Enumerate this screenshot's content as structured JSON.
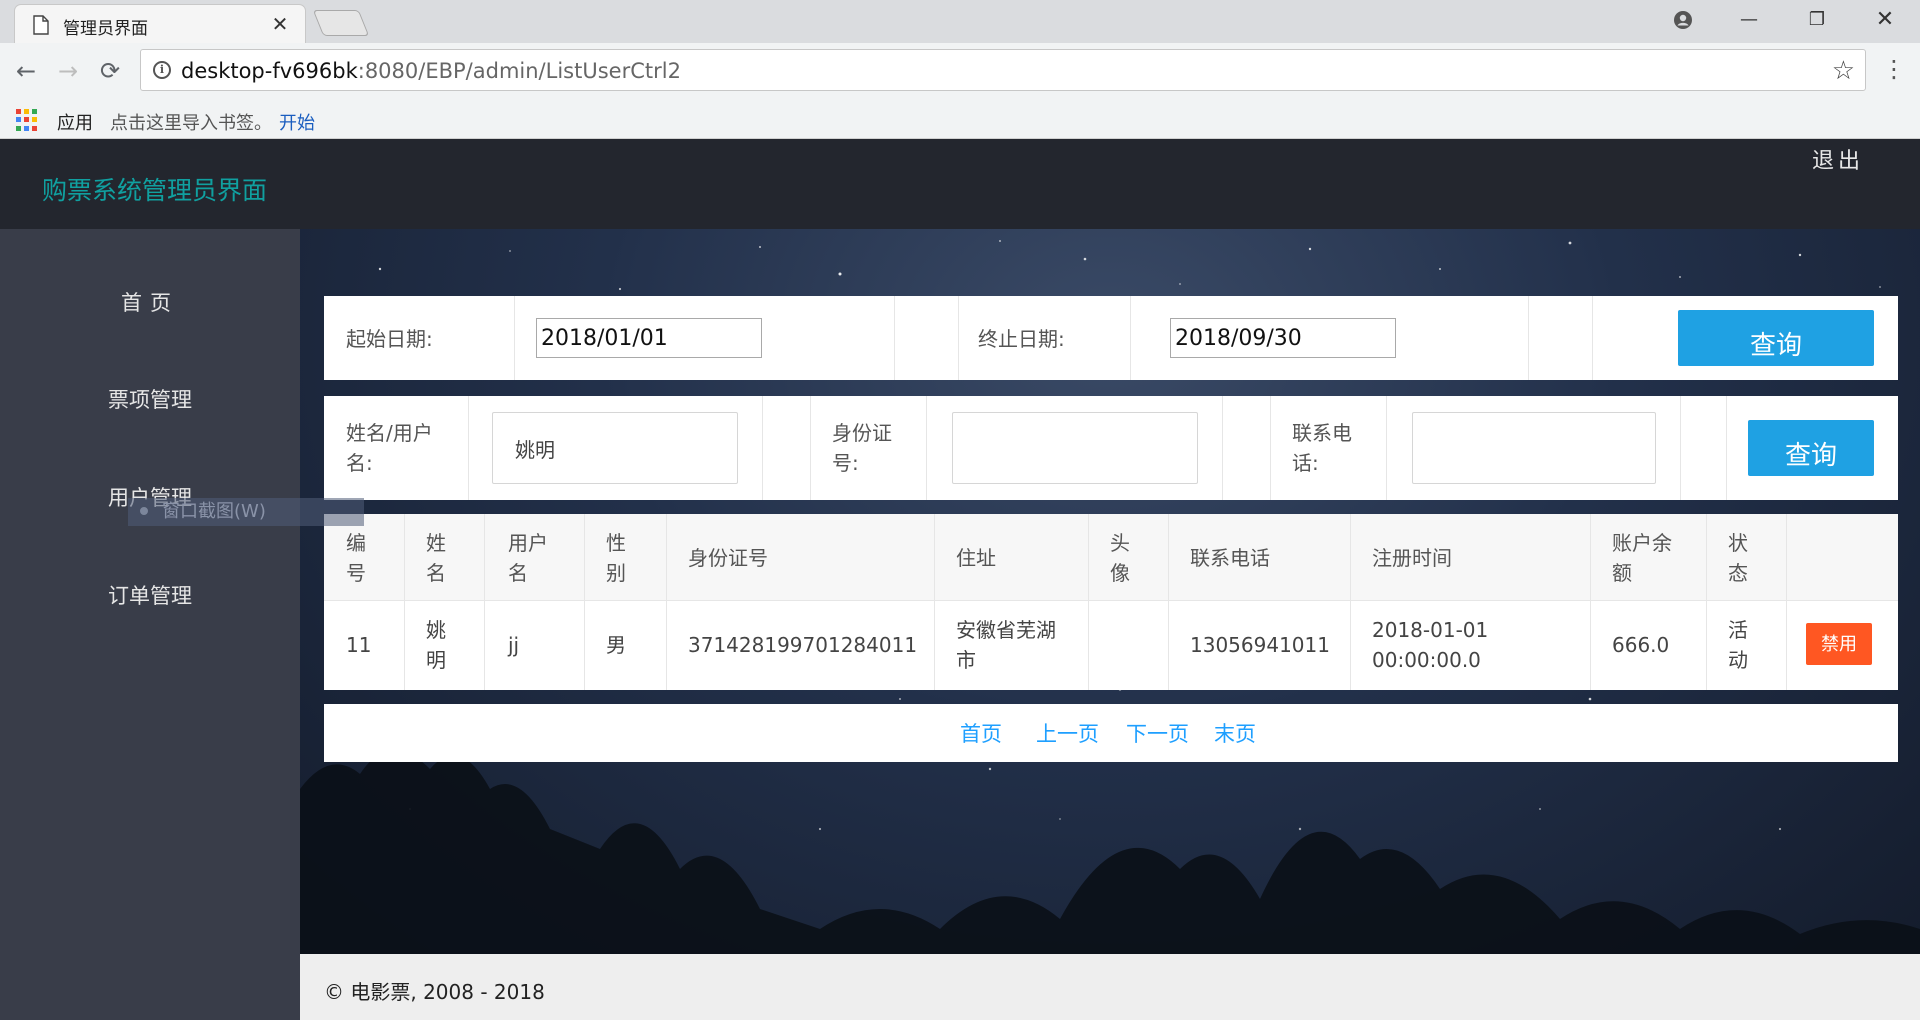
{
  "browser": {
    "tab_title": "管理员界面",
    "url_host": "desktop-fv696bk",
    "url_rest": ":8080/EBP/admin/ListUserCtrl2",
    "bookmarks": {
      "apps": "应用",
      "hint": "点击这里导入书签。",
      "start": "开始"
    }
  },
  "header": {
    "title": "购票系统管理员界面",
    "logout": "退出"
  },
  "sidebar": {
    "items": [
      {
        "label": "首页"
      },
      {
        "label": "票项管理"
      },
      {
        "label": "用户管理"
      },
      {
        "label": "订单管理"
      }
    ],
    "overlay_tip": "窗口截图(W)"
  },
  "date_filter": {
    "start_label": "起始日期:",
    "start_value": "2018/01/01",
    "end_label": "终止日期:",
    "end_value": "2018/09/30",
    "button": "查询"
  },
  "user_filter": {
    "name_label_1": "姓名/用户",
    "name_label_2": "名:",
    "name_value": "姚明",
    "id_label_1": "身份证",
    "id_label_2": "号:",
    "id_value": "",
    "phone_label_1": "联系电",
    "phone_label_2": "话:",
    "phone_value": "",
    "button": "查询"
  },
  "table": {
    "headers": [
      [
        "编",
        "号"
      ],
      [
        "姓",
        "名"
      ],
      [
        "用户",
        "名"
      ],
      [
        "性",
        "别"
      ],
      [
        "身份证号"
      ],
      [
        "住址"
      ],
      [
        "头",
        "像"
      ],
      [
        "联系电话"
      ],
      [
        "注册时间"
      ],
      [
        "账户余",
        "额"
      ],
      [
        "状",
        "态"
      ]
    ],
    "rows": [
      {
        "id": "11",
        "name": [
          "姚",
          "明"
        ],
        "username": "jj",
        "gender": "男",
        "id_number": "371428199701284011",
        "address": [
          "安徽省芜湖",
          "市"
        ],
        "avatar": "",
        "phone": "13056941011",
        "registered": [
          "2018-01-01",
          "00:00:00.0"
        ],
        "balance": "666.0",
        "status": [
          "活",
          "动"
        ],
        "action": "禁用"
      }
    ]
  },
  "pager": {
    "first": "首页",
    "prev": "上一页",
    "next": "下一页",
    "last": "末页"
  },
  "footer": {
    "text": "© 电影票, 2008 - 2018"
  },
  "colors": {
    "header_bg": "#23262e",
    "sidebar_bg": "#393d49",
    "brand": "#10a0a0",
    "query_button": "#1fa1e3",
    "danger_button": "#ff5722",
    "link": "#1e9fff"
  }
}
